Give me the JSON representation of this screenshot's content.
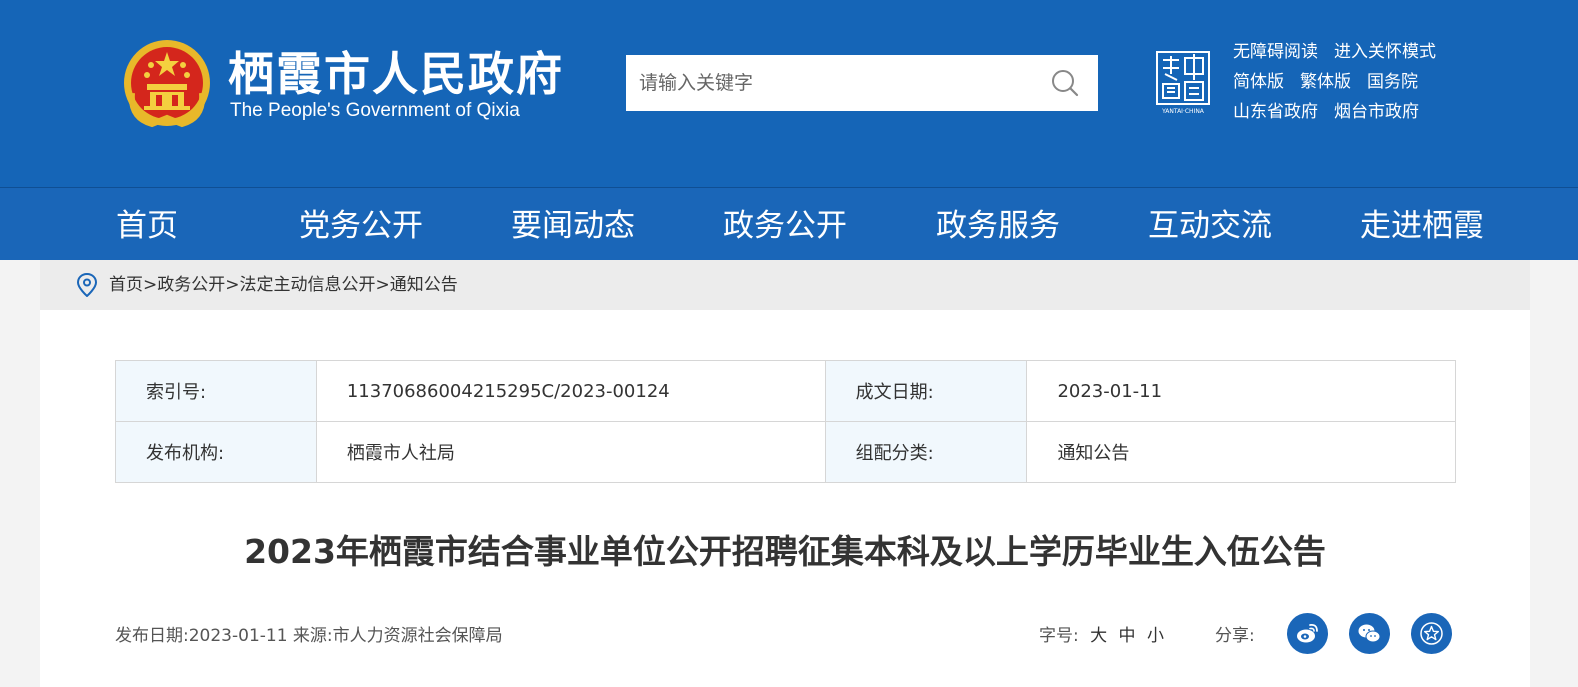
{
  "header": {
    "site_name_cn": "栖霞市人民政府",
    "site_name_en": "The People's Government of Qixia",
    "search": {
      "placeholder": "请输入关键字"
    },
    "top_links": [
      [
        "无障碍阅读",
        "进入关怀模式"
      ],
      [
        "简体版",
        "繁体版",
        "国务院"
      ],
      [
        "山东省政府",
        "烟台市政府"
      ]
    ],
    "logo_caption": "YANTAI·CHINA"
  },
  "nav": [
    "首页",
    "党务公开",
    "要闻动态",
    "政务公开",
    "政务服务",
    "互动交流",
    "走进栖霞"
  ],
  "breadcrumb": [
    "首页",
    "政务公开",
    "法定主动信息公开",
    "通知公告"
  ],
  "breadcrumb_separator": ">",
  "meta": {
    "index_label": "索引号:",
    "index_value": "11370686004215295C/2023-00124",
    "date_label": "成文日期:",
    "date_value": "2023-01-11",
    "org_label": "发布机构:",
    "org_value": "栖霞市人社局",
    "category_label": "组配分类:",
    "category_value": "通知公告"
  },
  "article": {
    "title": "2023年栖霞市结合事业单位公开招聘征集本科及以上学历毕业生入伍公告",
    "publish_info": "发布日期:2023-01-11 来源:市人力资源社会保障局",
    "font_size_label": "字号:",
    "font_sizes": [
      "大",
      "中",
      "小"
    ],
    "share_label": "分享:",
    "share_icons": [
      "weibo-icon",
      "wechat-icon",
      "favorite-star-icon"
    ]
  },
  "colors": {
    "brand_blue": "#1565b7",
    "breadcrumb_bg": "#ececec",
    "key_cell_bg": "#f1f8fd"
  }
}
